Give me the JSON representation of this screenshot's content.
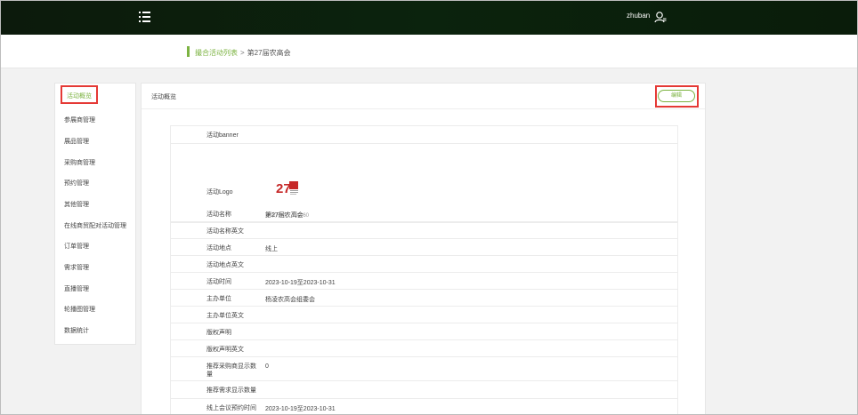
{
  "header": {
    "username": "zhuban"
  },
  "breadcrumb": {
    "parent": "撮合活动列表",
    "separator": ">",
    "current": "第27届农高会"
  },
  "sidebar": {
    "items": [
      {
        "label": "活动概览"
      },
      {
        "label": "参展商管理"
      },
      {
        "label": "展品管理"
      },
      {
        "label": "采购商管理"
      },
      {
        "label": "预约管理"
      },
      {
        "label": "其他管理"
      },
      {
        "label": "在线商贸配对活动管理"
      },
      {
        "label": "订单管理"
      },
      {
        "label": "需求管理"
      },
      {
        "label": "直播管理"
      },
      {
        "label": "轮播图管理"
      },
      {
        "label": "数据统计"
      }
    ]
  },
  "panel": {
    "title": "活动概览",
    "edit_label": "编辑"
  },
  "details": {
    "rows": [
      {
        "key": "活动banner",
        "value": ""
      },
      {
        "key": "活动Logo",
        "value": "",
        "hint": "建议尺寸：120*60"
      },
      {
        "key": "活动名称",
        "value": "第27届农高会"
      },
      {
        "key": "活动名称英文",
        "value": ""
      },
      {
        "key": "活动地点",
        "value": "线上"
      },
      {
        "key": "活动地点英文",
        "value": ""
      },
      {
        "key": "活动时间",
        "value": "2023-10-19至2023-10-31"
      },
      {
        "key": "主办单位",
        "value": "杨凌农高会组委会"
      },
      {
        "key": "主办单位英文",
        "value": ""
      },
      {
        "key": "版权声明",
        "value": ""
      },
      {
        "key": "版权声明英文",
        "value": ""
      },
      {
        "key": "推荐采购商显示数量",
        "value": "0"
      },
      {
        "key": "推荐需求显示数量",
        "value": ""
      },
      {
        "key": "线上会议预约时间",
        "value": "2023-10-19至2023-10-31"
      }
    ]
  },
  "colors": {
    "accent": "#7cb342",
    "highlight": "#e53935",
    "topbar": "#0b230d"
  }
}
